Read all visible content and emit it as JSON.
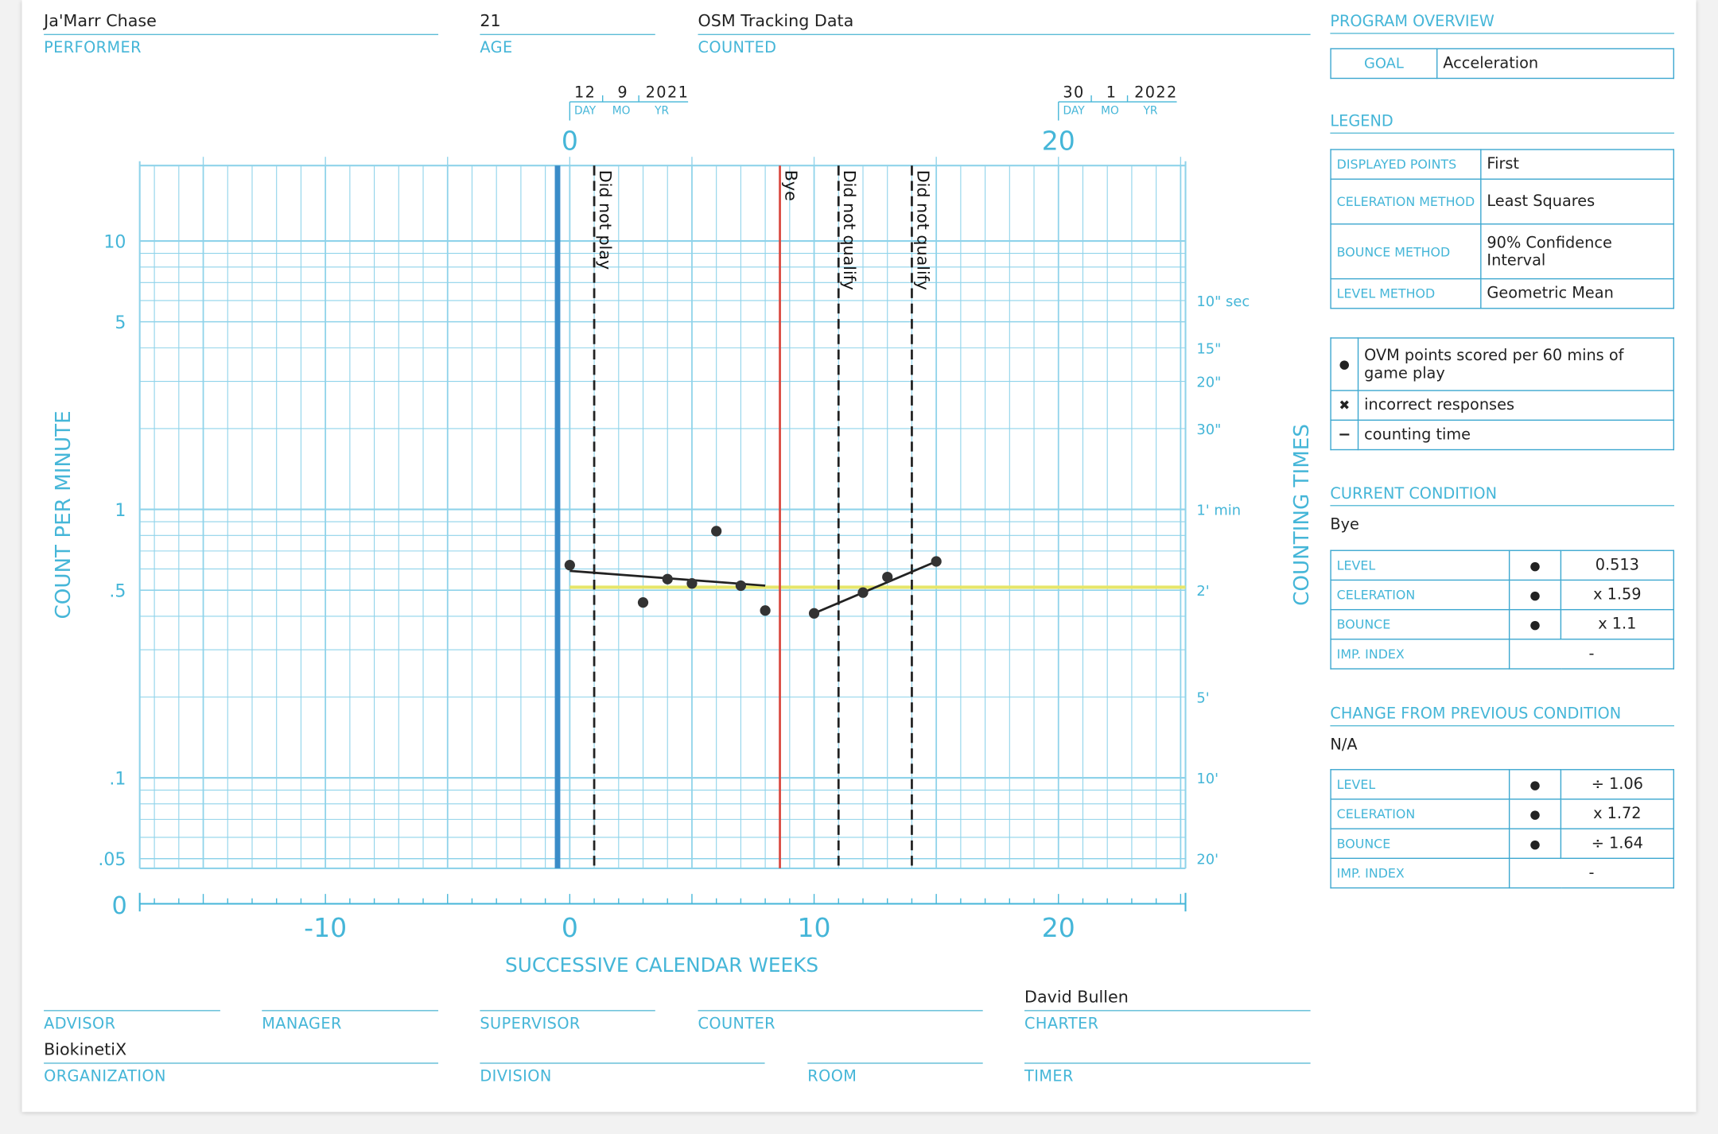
{
  "header": {
    "performer": "Ja'Marr Chase",
    "performer_label": "PERFORMER",
    "age": "21",
    "age_label": "AGE",
    "counted": "OSM Tracking Data",
    "counted_label": "COUNTED"
  },
  "program_overview": {
    "title": "PROGRAM OVERVIEW",
    "goal_label": "GOAL",
    "goal": "Acceleration"
  },
  "legend": {
    "title": "LEGEND",
    "rows": [
      {
        "k": "DISPLAYED POINTS",
        "v": "First"
      },
      {
        "k": "CELERATION METHOD",
        "v": "Least Squares"
      },
      {
        "k": "BOUNCE METHOD",
        "v": "90% Confidence Interval"
      },
      {
        "k": "LEVEL METHOD",
        "v": "Geometric Mean"
      }
    ],
    "symbols": [
      {
        "icon": "dot-icon",
        "glyph": "●",
        "label": "OVM points scored per 60 mins of game play"
      },
      {
        "icon": "cross-icon",
        "glyph": "✖",
        "label": "incorrect responses"
      },
      {
        "icon": "dash-icon",
        "glyph": "−",
        "label": "counting time"
      }
    ]
  },
  "current_condition": {
    "title": "CURRENT CONDITION",
    "name": "Bye",
    "rows": [
      {
        "k": "LEVEL",
        "sym": "●",
        "v": "0.513"
      },
      {
        "k": "CELERATION",
        "sym": "●",
        "v": "x 1.59"
      },
      {
        "k": "BOUNCE",
        "sym": "●",
        "v": "x 1.1"
      },
      {
        "k": "IMP. INDEX",
        "sym": "",
        "v": "-"
      }
    ]
  },
  "change_condition": {
    "title": "CHANGE FROM PREVIOUS CONDITION",
    "name": "N/A",
    "rows": [
      {
        "k": "LEVEL",
        "sym": "●",
        "v": "÷ 1.06"
      },
      {
        "k": "CELERATION",
        "sym": "●",
        "v": "x 1.72"
      },
      {
        "k": "BOUNCE",
        "sym": "●",
        "v": "÷ 1.64"
      },
      {
        "k": "IMP. INDEX",
        "sym": "",
        "v": "-"
      }
    ]
  },
  "footer": {
    "advisor_label": "ADVISOR",
    "manager_label": "MANAGER",
    "supervisor_label": "SUPERVISOR",
    "counter_label": "COUNTER",
    "charter": "David Bullen",
    "charter_label": "CHARTER",
    "organization": "BiokinetiX",
    "organization_label": "ORGANIZATION",
    "division_label": "DIVISION",
    "room_label": "ROOM",
    "timer_label": "TIMER"
  },
  "chart_data": {
    "type": "scatter",
    "xlabel": "SUCCESSIVE CALENDAR WEEKS",
    "ylabel": "COUNT PER MINUTE",
    "y2label": "COUNTING TIMES",
    "xlim": [
      -17.6,
      25.2
    ],
    "ylim": [
      0.046,
      19.1
    ],
    "yscale": "log",
    "grid": true,
    "x_ticks": [
      {
        "v": -10,
        "t": "-10"
      },
      {
        "v": 0,
        "t": "0"
      },
      {
        "v": 10,
        "t": "10"
      },
      {
        "v": 20,
        "t": "20"
      }
    ],
    "x_origin_label": "0",
    "top_ticks": [
      {
        "v": 0,
        "t": "0"
      },
      {
        "v": 20,
        "t": "20"
      }
    ],
    "dates": [
      {
        "v": 0,
        "day": "12",
        "mo": "9",
        "yr": "2021"
      },
      {
        "v": 20,
        "day": "30",
        "mo": "1",
        "yr": "2022"
      }
    ],
    "date_labels": {
      "day": "DAY",
      "mo": "MO",
      "yr": "YR"
    },
    "y_ticks": [
      {
        "v": 10,
        "t": "10"
      },
      {
        "v": 5,
        "t": "5"
      },
      {
        "v": 1,
        "t": "1"
      },
      {
        "v": 0.5,
        "t": ".5"
      },
      {
        "v": 0.1,
        "t": ".1"
      },
      {
        "v": 0.05,
        "t": ".05"
      }
    ],
    "y2_ticks": [
      {
        "v": 6,
        "t": "10\" sec"
      },
      {
        "v": 4,
        "t": "15\""
      },
      {
        "v": 3,
        "t": "20\""
      },
      {
        "v": 2,
        "t": "30\""
      },
      {
        "v": 1,
        "t": "1' min"
      },
      {
        "v": 0.5,
        "t": "2'"
      },
      {
        "v": 0.2,
        "t": "5'"
      },
      {
        "v": 0.1,
        "t": "10'"
      },
      {
        "v": 0.05,
        "t": "20'"
      }
    ],
    "series": [
      {
        "name": "OVM points scored per 60 mins of game play",
        "x": [
          0,
          3,
          4,
          5,
          6,
          7,
          8,
          10,
          12,
          13,
          15
        ],
        "y": [
          0.62,
          0.45,
          0.55,
          0.53,
          0.83,
          0.52,
          0.42,
          0.41,
          0.49,
          0.56,
          0.64
        ]
      }
    ],
    "trend_lines": [
      {
        "x": [
          0,
          8
        ],
        "y": [
          0.59,
          0.52
        ]
      },
      {
        "x": [
          10,
          15
        ],
        "y": [
          0.41,
          0.64
        ]
      }
    ],
    "level_line": {
      "value": 0.513,
      "x_from": 0,
      "color": "#e6e66a"
    },
    "phase_lines": [
      {
        "x": -0.5,
        "style": "solid",
        "color": "#3a8cc8",
        "label": ""
      },
      {
        "x": 1,
        "style": "dashed",
        "color": "#222222",
        "label": "Did not play"
      },
      {
        "x": 8.6,
        "style": "solid",
        "color": "#d9493f",
        "label": "Bye"
      },
      {
        "x": 11,
        "style": "dashed",
        "color": "#222222",
        "label": "Did not qualify"
      },
      {
        "x": 14,
        "style": "dashed",
        "color": "#222222",
        "label": "Did not qualify"
      }
    ],
    "colors": {
      "grid": "#8fd3ea",
      "accent": "#45b6d8",
      "point": "#333333"
    }
  }
}
